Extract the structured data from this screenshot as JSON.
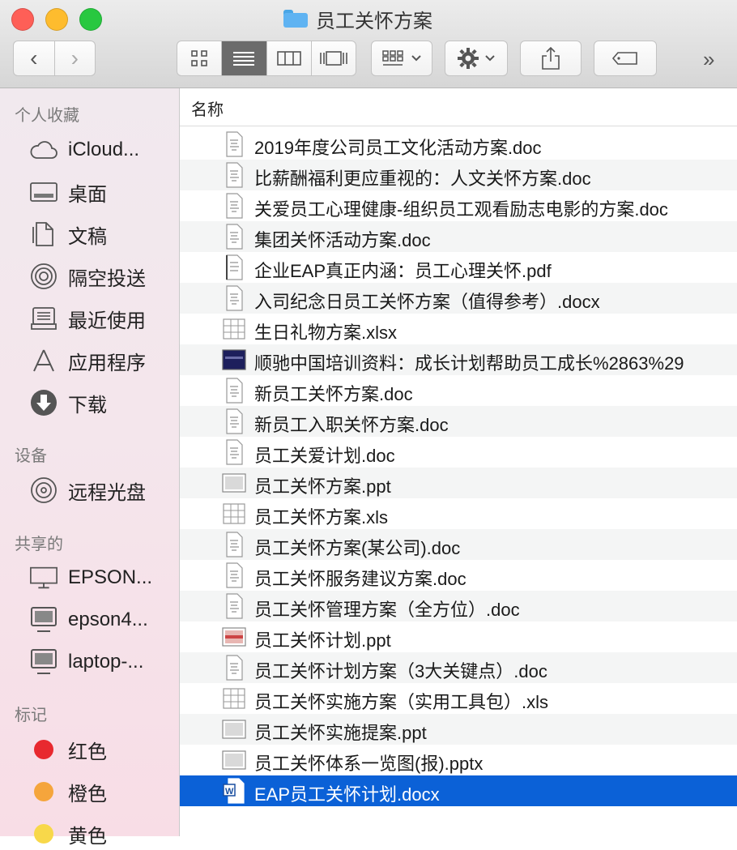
{
  "window": {
    "title": "员工关怀方案"
  },
  "toolbar": {
    "back_glyph": "‹",
    "forward_glyph": "›",
    "more_glyph": "»"
  },
  "sidebar": {
    "favorites_title": "个人收藏",
    "favorites": [
      {
        "label": "iCloud...",
        "icon": "cloud-icon"
      },
      {
        "label": "桌面",
        "icon": "desktop-icon"
      },
      {
        "label": "文稿",
        "icon": "documents-icon"
      },
      {
        "label": "隔空投送",
        "icon": "airdrop-icon"
      },
      {
        "label": "最近使用",
        "icon": "recents-icon"
      },
      {
        "label": "应用程序",
        "icon": "applications-icon"
      },
      {
        "label": "下载",
        "icon": "downloads-icon"
      }
    ],
    "devices_title": "设备",
    "devices": [
      {
        "label": "远程光盘",
        "icon": "disc-icon"
      }
    ],
    "shared_title": "共享的",
    "shared": [
      {
        "label": "EPSON...",
        "icon": "display-icon"
      },
      {
        "label": "epson4...",
        "icon": "monitor-icon"
      },
      {
        "label": "laptop-...",
        "icon": "monitor-icon"
      }
    ],
    "tags_title": "标记",
    "tags": [
      {
        "label": "红色",
        "color": "#e8292f"
      },
      {
        "label": "橙色",
        "color": "#f5a53c"
      },
      {
        "label": "黄色",
        "color": "#f8d84a"
      }
    ]
  },
  "list": {
    "column_name": "名称",
    "files": [
      {
        "name": "2019年度公司员工文化活动方案.doc",
        "icon": "doc"
      },
      {
        "name": "比薪酬福利更应重视的：人文关怀方案.doc",
        "icon": "doc"
      },
      {
        "name": "关爱员工心理健康-组织员工观看励志电影的方案.doc",
        "icon": "doc"
      },
      {
        "name": "集团关怀活动方案.doc",
        "icon": "doc"
      },
      {
        "name": "企业EAP真正内涵：员工心理关怀.pdf",
        "icon": "pdf"
      },
      {
        "name": "入司纪念日员工关怀方案（值得参考）.docx",
        "icon": "doc"
      },
      {
        "name": "生日礼物方案.xlsx",
        "icon": "xls"
      },
      {
        "name": "顺驰中国培训资料：成长计划帮助员工成长%2863%29",
        "icon": "dark"
      },
      {
        "name": "新员工关怀方案.doc",
        "icon": "doc"
      },
      {
        "name": "新员工入职关怀方案.doc",
        "icon": "doc"
      },
      {
        "name": "员工关爱计划.doc",
        "icon": "doc"
      },
      {
        "name": "员工关怀方案.ppt",
        "icon": "ppt"
      },
      {
        "name": "员工关怀方案.xls",
        "icon": "xls"
      },
      {
        "name": "员工关怀方案(某公司).doc",
        "icon": "doc"
      },
      {
        "name": "员工关怀服务建议方案.doc",
        "icon": "doc"
      },
      {
        "name": "员工关怀管理方案（全方位）.doc",
        "icon": "doc"
      },
      {
        "name": "员工关怀计划.ppt",
        "icon": "pptred"
      },
      {
        "name": "员工关怀计划方案（3大关键点）.doc",
        "icon": "doc"
      },
      {
        "name": "员工关怀实施方案（实用工具包）.xls",
        "icon": "xls"
      },
      {
        "name": "员工关怀实施提案.ppt",
        "icon": "ppt"
      },
      {
        "name": "员工关怀体系一览图(报).pptx",
        "icon": "ppt"
      },
      {
        "name": "EAP员工关怀计划.docx",
        "icon": "word",
        "selected": true
      }
    ]
  },
  "colors": {
    "selection": "#0b61d7",
    "accent": "#5fb3f2"
  }
}
